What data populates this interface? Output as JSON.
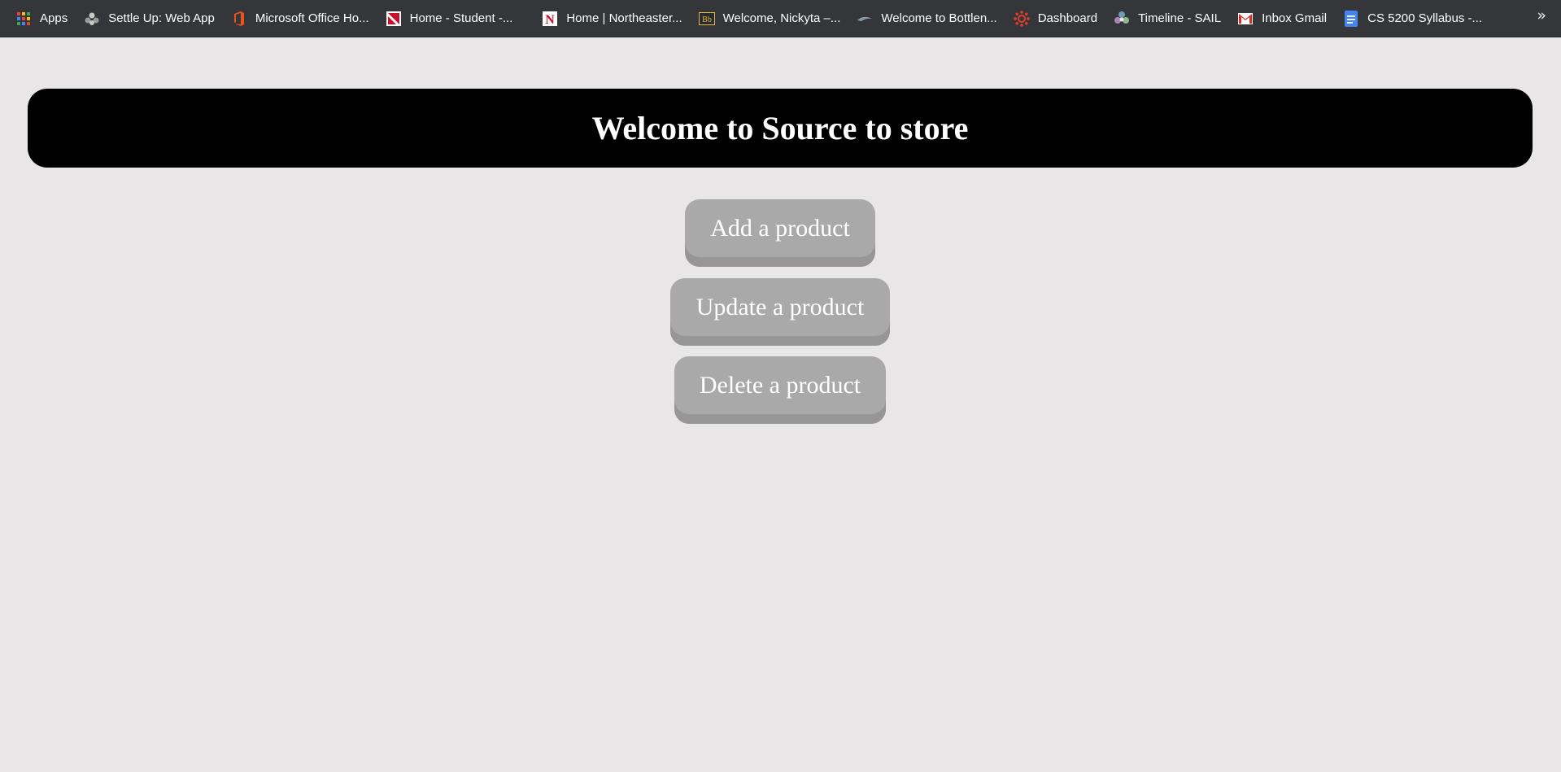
{
  "bookmarks": [
    {
      "label": "Apps",
      "icon": "apps-grid-icon"
    },
    {
      "label": "Settle Up: Web App",
      "icon": "settle-up-icon"
    },
    {
      "label": "Microsoft Office Ho...",
      "icon": "office-icon"
    },
    {
      "label": "Home - Student -...",
      "icon": "northeastern-student-icon"
    },
    {
      "label": "Home | Northeaster...",
      "icon": "northeastern-n-icon"
    },
    {
      "label": "Welcome, Nickyta –...",
      "icon": "blackboard-icon"
    },
    {
      "label": "Welcome to Bottlen...",
      "icon": "bottlenose-icon"
    },
    {
      "label": "Dashboard",
      "icon": "canvas-dashboard-icon"
    },
    {
      "label": "Timeline - SAIL",
      "icon": "sail-icon"
    },
    {
      "label": "Inbox  Gmail",
      "icon": "gmail-icon"
    },
    {
      "label": "CS 5200 Syllabus -...",
      "icon": "google-docs-icon"
    }
  ],
  "overflow": "»",
  "page": {
    "title": "Welcome to Source to store",
    "buttons": {
      "add": "Add a product",
      "update": "Update a product",
      "delete": "Delete a product"
    }
  },
  "colors": {
    "background": "#e8e6e7",
    "bookmarks_bar": "#35363a",
    "header_banner": "#000000",
    "button": "#a9a9a9"
  }
}
